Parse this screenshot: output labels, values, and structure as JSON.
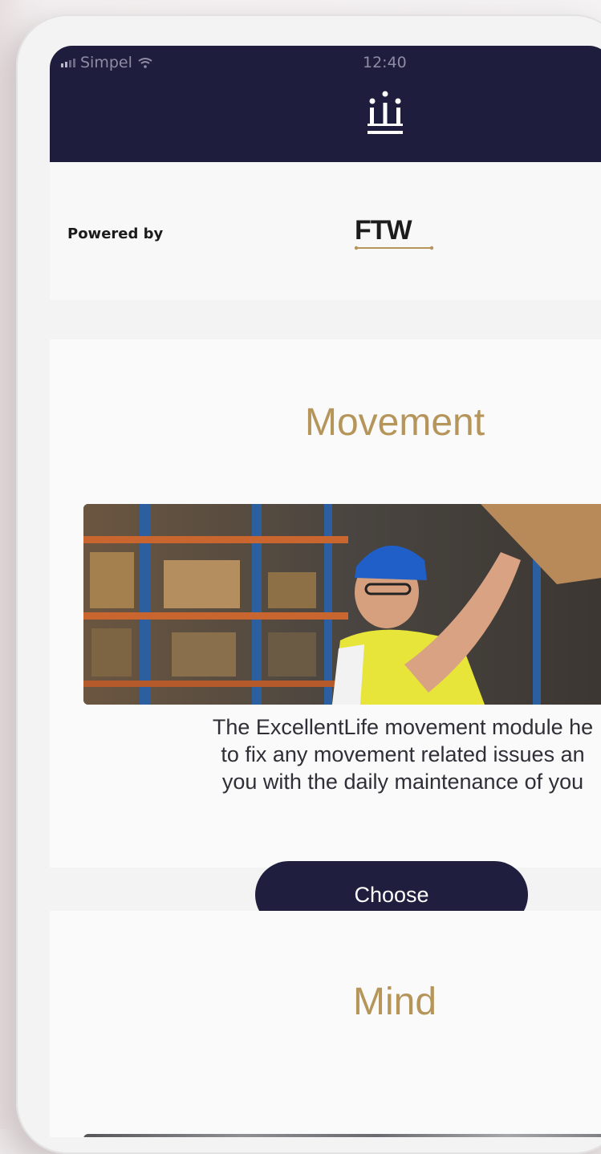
{
  "status_bar": {
    "carrier": "Simpel",
    "time": "12:40"
  },
  "header": {
    "logo_icon": "crown-logo-icon"
  },
  "powered": {
    "label": "Powered by",
    "brand": "FTW"
  },
  "modules": [
    {
      "title": "Movement",
      "description": "The ExcellentLife movement module he\nto fix any movement related issues an\nyou with the daily maintenance of you",
      "button_label": "Choose"
    },
    {
      "title": "Mind"
    }
  ],
  "colors": {
    "navy": "#1f1d3d",
    "gold": "#b5955a",
    "text": "#2f2f37"
  }
}
